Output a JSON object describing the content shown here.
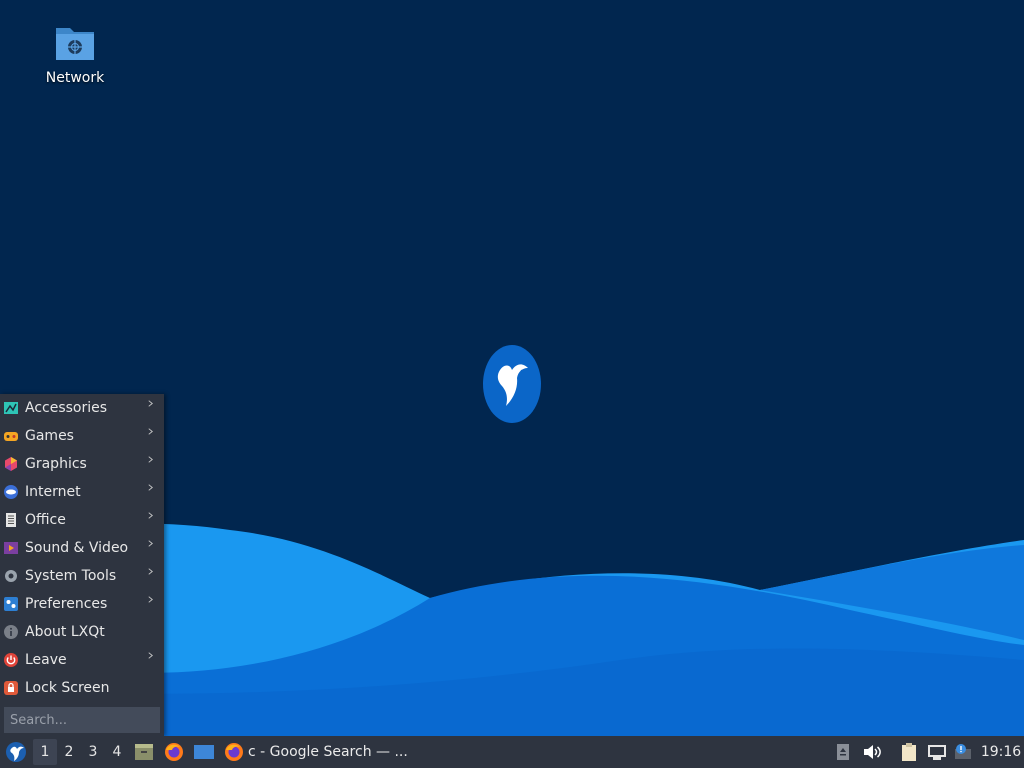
{
  "desktop": {
    "icons": [
      {
        "label": "Network",
        "icon": "network-folder-icon"
      }
    ],
    "logo": "hummingbird-logo-icon"
  },
  "start_menu": {
    "items": [
      {
        "label": "Accessories",
        "icon": "accessories-icon",
        "submenu": true
      },
      {
        "label": "Games",
        "icon": "games-icon",
        "submenu": true
      },
      {
        "label": "Graphics",
        "icon": "graphics-icon",
        "submenu": true
      },
      {
        "label": "Internet",
        "icon": "internet-icon",
        "submenu": true
      },
      {
        "label": "Office",
        "icon": "office-icon",
        "submenu": true
      },
      {
        "label": "Sound & Video",
        "icon": "sound-video-icon",
        "submenu": true
      },
      {
        "label": "System Tools",
        "icon": "system-tools-icon",
        "submenu": true
      },
      {
        "label": "Preferences",
        "icon": "preferences-icon",
        "submenu": true
      },
      {
        "label": "About LXQt",
        "icon": "info-icon",
        "submenu": false
      },
      {
        "label": "Leave",
        "icon": "power-icon",
        "submenu": true
      },
      {
        "label": "Lock Screen",
        "icon": "lock-icon",
        "submenu": false
      }
    ],
    "search_placeholder": "Search..."
  },
  "taskbar": {
    "workspaces": [
      "1",
      "2",
      "3",
      "4"
    ],
    "active_workspace": "1",
    "quicklaunch": [
      "file-manager-icon",
      "firefox-icon",
      "desktop-icon"
    ],
    "task_title": "c - Google Search — ...",
    "tray": [
      "tray-arrow-icon",
      "volume-icon",
      "clipboard-icon",
      "network-icon",
      "update-notifier-icon"
    ],
    "clock": "19:16"
  },
  "colors": {
    "sky": "#01264f",
    "wave_light": "#1a98f0",
    "wave_mid": "#1380e2",
    "wave_deep": "#0a6fd6",
    "panel": "#2e3440"
  }
}
